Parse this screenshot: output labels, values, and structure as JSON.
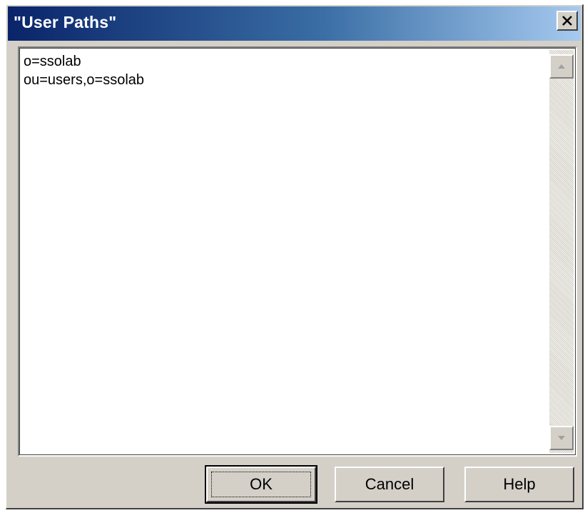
{
  "dialog": {
    "title": "\"User Paths\"",
    "close_icon": "close-x-icon"
  },
  "list": {
    "items": [
      "o=ssolab",
      "ou=users,o=ssolab"
    ]
  },
  "scrollbar": {
    "up_icon": "scroll-up-arrow-icon",
    "down_icon": "scroll-down-arrow-icon"
  },
  "buttons": {
    "ok_label": "OK",
    "cancel_label": "Cancel",
    "help_label": "Help"
  },
  "colors": {
    "title_gradient_start": "#0a246a",
    "title_gradient_end": "#a6caf0",
    "face": "#d4d0c8"
  }
}
